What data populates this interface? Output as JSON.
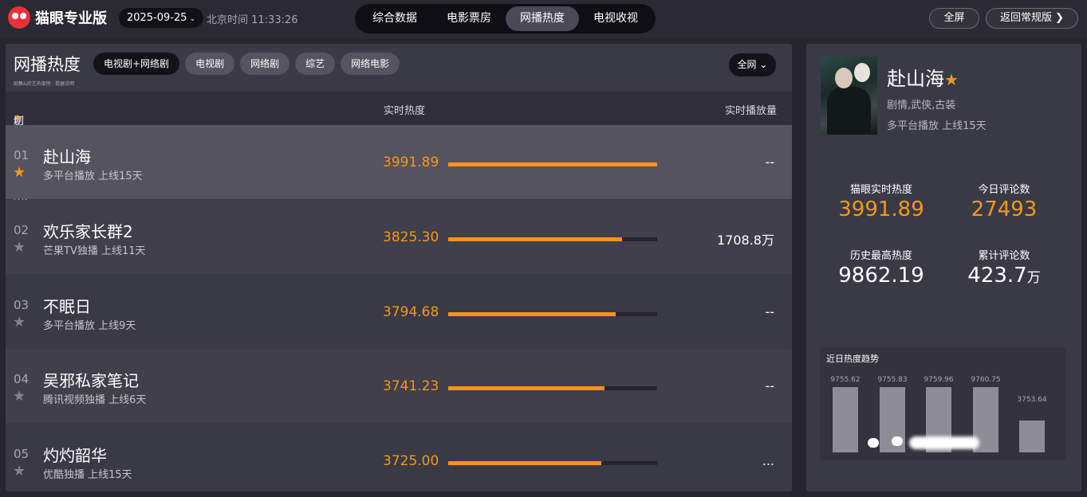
{
  "header": {
    "app_name": "猫眼专业版",
    "date": "2025-09-25",
    "clock_label": "北京时间 11:33:26",
    "nav_tabs": [
      {
        "label": "综合数据"
      },
      {
        "label": "电影票房"
      },
      {
        "label": "网播热度",
        "active": true
      },
      {
        "label": "电视收视"
      }
    ],
    "fullscreen_label": "全屏",
    "back_label": "返回常规版 ❯"
  },
  "left": {
    "title": "网播热度",
    "subtitle": "剧集&综艺热度榜 · 数据说明",
    "filters": [
      {
        "label": "电视剧+网络剧",
        "active": true
      },
      {
        "label": "电视剧"
      },
      {
        "label": "网络剧"
      },
      {
        "label": "综艺"
      },
      {
        "label": "网络电影"
      }
    ],
    "region_label": "全网",
    "table_headers": {
      "col_name_prefix": "剧集(点击",
      "col_name_suffix": "切换右侧展示)",
      "col_heat": "实时热度",
      "col_play": "实时播放量"
    },
    "rows": [
      {
        "rank": "01",
        "name": "赴山海",
        "meta": "多平台播放  上线15天",
        "heat": "3991.89",
        "heat_value": 3991.89,
        "play": "--",
        "starred": true
      },
      {
        "rank": "02",
        "name": "欢乐家长群2",
        "meta": "芒果TV独播  上线11天",
        "heat": "3825.30",
        "heat_value": 3825.3,
        "play": "1708.8万",
        "starred": false
      },
      {
        "rank": "03",
        "name": "不眠日",
        "meta": "多平台播放  上线9天",
        "heat": "3794.68",
        "heat_value": 3794.68,
        "play": "--",
        "starred": false
      },
      {
        "rank": "04",
        "name": "吴邪私家笔记",
        "meta": "腾讯视频独播  上线6天",
        "heat": "3741.23",
        "heat_value": 3741.23,
        "play": "--",
        "starred": false
      },
      {
        "rank": "05",
        "name": "灼灼韶华",
        "meta": "优酷独播  上线15天",
        "heat": "3725.00",
        "heat_value": 3725.0,
        "play": "...",
        "starred": false
      }
    ]
  },
  "right": {
    "title": "赴山海",
    "genre": "剧情,武侠,古装",
    "meta": "多平台播放  上线15天",
    "stats": {
      "realtime_heat_label": "猫眼实时热度",
      "realtime_heat": "3991.89",
      "today_comments_label": "今日评论数",
      "today_comments": "27493",
      "max_heat_label": "历史最高热度",
      "max_heat": "9862.19",
      "total_comments_label": "累计评论数",
      "total_comments": "423.7",
      "total_comments_unit": "万"
    },
    "trend": {
      "title": "近日热度趋势",
      "points": [
        {
          "label": "9755.62",
          "value": 9755.62
        },
        {
          "label": "9755.83",
          "value": 9755.83
        },
        {
          "label": "9759.96",
          "value": 9759.96
        },
        {
          "label": "9760.75",
          "value": 9760.75
        },
        {
          "label": "3753.64",
          "value": 3753.64
        }
      ]
    }
  },
  "colors": {
    "accent": "#f19a1a",
    "bar": "#f7931c",
    "panel": "#3a3946",
    "background": "#26252e"
  }
}
